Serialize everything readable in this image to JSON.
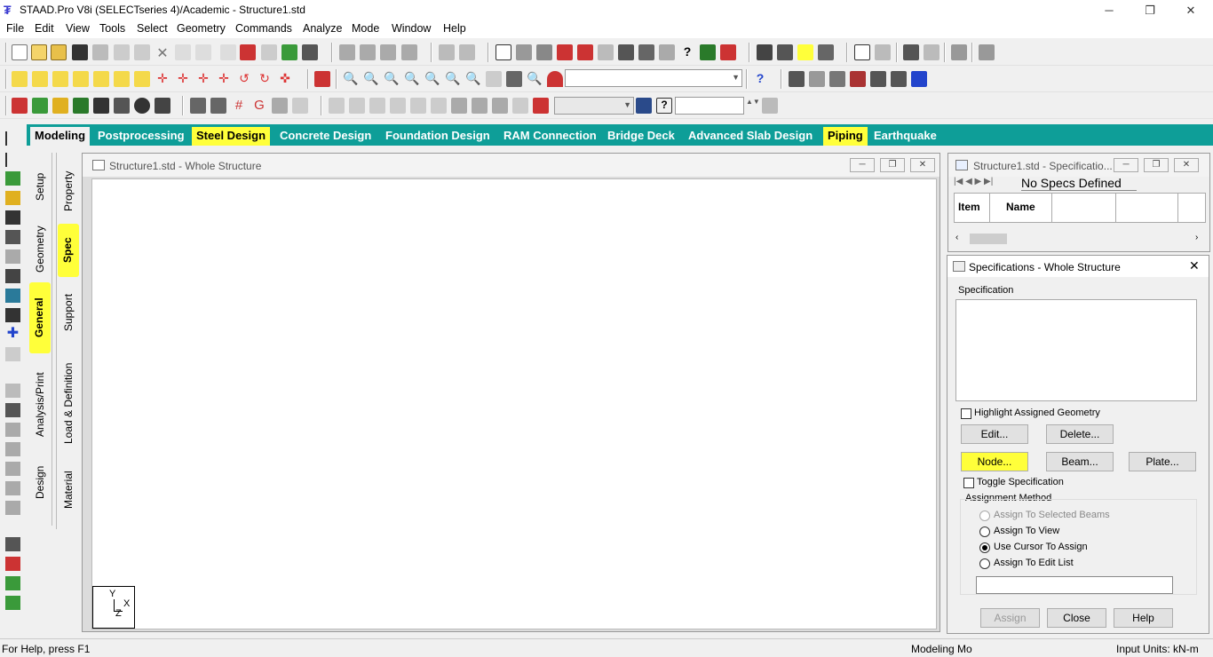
{
  "window": {
    "title": "STAAD.Pro V8i (SELECTseries 4)/Academic - Structure1.std",
    "minimize": "─",
    "restore": "❐",
    "close": "✕"
  },
  "menu": [
    "File",
    "Edit",
    "View",
    "Tools",
    "Select",
    "Geometry",
    "Commands",
    "Analyze",
    "Mode",
    "Window",
    "Help"
  ],
  "tabs": [
    "Modeling",
    "Postprocessing",
    "Steel Design",
    "Concrete Design",
    "Foundation Design",
    "RAM Connection",
    "Bridge Deck",
    "Advanced Slab Design",
    "Piping",
    "Earthquake"
  ],
  "side_tabs_outer": [
    "Setup",
    "Geometry",
    "General",
    "Analysis/Print",
    "Design"
  ],
  "side_tabs_inner": [
    "Property",
    "Spec",
    "Support",
    "Load & Definition",
    "Material"
  ],
  "main_view": {
    "title": "Structure1.std - Whole Structure",
    "axis_y": "Y",
    "axis_x": "X",
    "axis_z": "Z"
  },
  "spec_table": {
    "title": "Structure1.std - Specificatio...",
    "sheet_tab": "No Specs Defined",
    "columns": [
      "Item",
      "Name",
      "",
      ""
    ]
  },
  "spec_dialog": {
    "title": "Specifications - Whole Structure",
    "specification_label": "Specification",
    "highlight_label": "Highlight Assigned Geometry",
    "edit": "Edit...",
    "delete": "Delete...",
    "node": "Node...",
    "beam": "Beam...",
    "plate": "Plate...",
    "toggle_label": "Toggle Specification",
    "assignment_label": "Assignment Method",
    "opt_selected": "Assign To Selected Beams",
    "opt_view": "Assign To View",
    "opt_cursor": "Use Cursor To Assign",
    "opt_editlist": "Assign To Edit List",
    "assign": "Assign",
    "close": "Close",
    "help": "Help"
  },
  "status": {
    "help": "For Help, press F1",
    "mode": "Modeling Mo",
    "units": "Input Units:  kN-m"
  },
  "colors": {
    "tab_bar": "#0e9e98",
    "highlight": "#ffff3a"
  }
}
